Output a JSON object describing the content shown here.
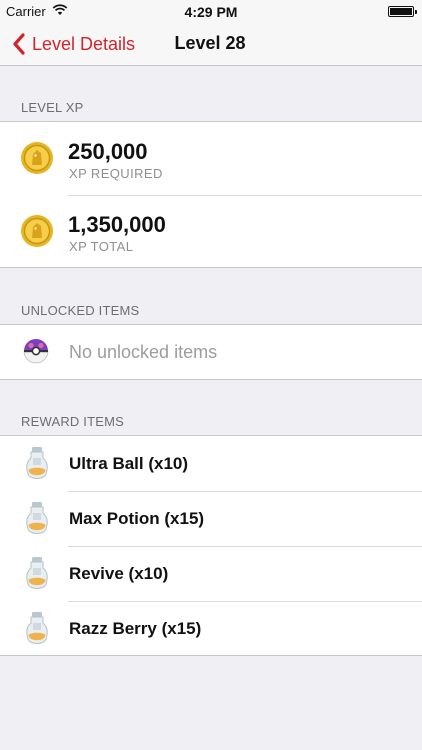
{
  "status_bar": {
    "carrier": "Carrier",
    "time": "4:29 PM"
  },
  "nav": {
    "back_label": "Level Details",
    "title": "Level 28"
  },
  "level_xp": {
    "header": "LEVEL XP",
    "rows": [
      {
        "value": "250,000",
        "caption": "XP REQUIRED",
        "icon": "gold-medal-icon"
      },
      {
        "value": "1,350,000",
        "caption": "XP TOTAL",
        "icon": "gold-medal-icon"
      }
    ]
  },
  "unlocked_items": {
    "header": "UNLOCKED ITEMS",
    "empty_text": "No unlocked items",
    "icon": "master-ball-icon"
  },
  "reward_items": {
    "header": "REWARD ITEMS",
    "items": [
      {
        "label": "Ultra Ball (x10)",
        "icon": "potion-icon"
      },
      {
        "label": "Max Potion (x15)",
        "icon": "potion-icon"
      },
      {
        "label": "Revive (x10)",
        "icon": "potion-icon"
      },
      {
        "label": "Razz Berry (x15)",
        "icon": "potion-icon"
      }
    ]
  },
  "colors": {
    "accent": "#d0252c",
    "background": "#efeff4",
    "gold": "#e7b521"
  }
}
